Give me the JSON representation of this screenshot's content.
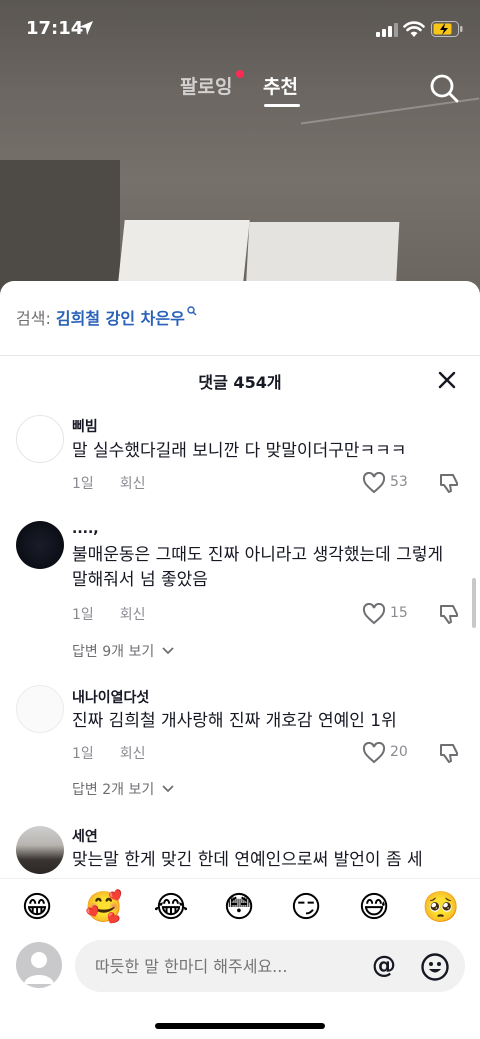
{
  "status": {
    "time": "17:14"
  },
  "nav": {
    "following": "팔로잉",
    "for_you": "추천"
  },
  "search_suggestion": {
    "prefix": "검색: ",
    "term": "김희철 강인 차은우"
  },
  "sheet": {
    "title": "댓글 454개"
  },
  "comments": [
    {
      "user": "삐빔",
      "text": "말 실수했다길래 보니깐 다 맞말이더구만ㅋㅋㅋ",
      "time": "1일",
      "reply": "회신",
      "likes": "53"
    },
    {
      "user": "....,",
      "text": "불매운동은 그때도 진짜 아니라고 생각했는데 그렇게 말해줘서 넘 좋았음",
      "time": "1일",
      "reply": "회신",
      "likes": "15",
      "more_replies": "답변 9개 보기"
    },
    {
      "user": "내나이열다섯",
      "text": "진짜 김희철 개사랑해 진짜 개호감 연예인 1위",
      "time": "1일",
      "reply": "회신",
      "likes": "20",
      "more_replies": "답변 2개 보기"
    },
    {
      "user": "세연",
      "text": "맞는말 한게 맞긴 한데 연예인으로써 발언이 좀 세"
    }
  ],
  "emojis": [
    "😁",
    "🥰",
    "😂",
    "😳",
    "😏",
    "😅",
    "🥺"
  ],
  "input": {
    "placeholder": "따듯한 말 한마디 해주세요...",
    "at": "@"
  }
}
